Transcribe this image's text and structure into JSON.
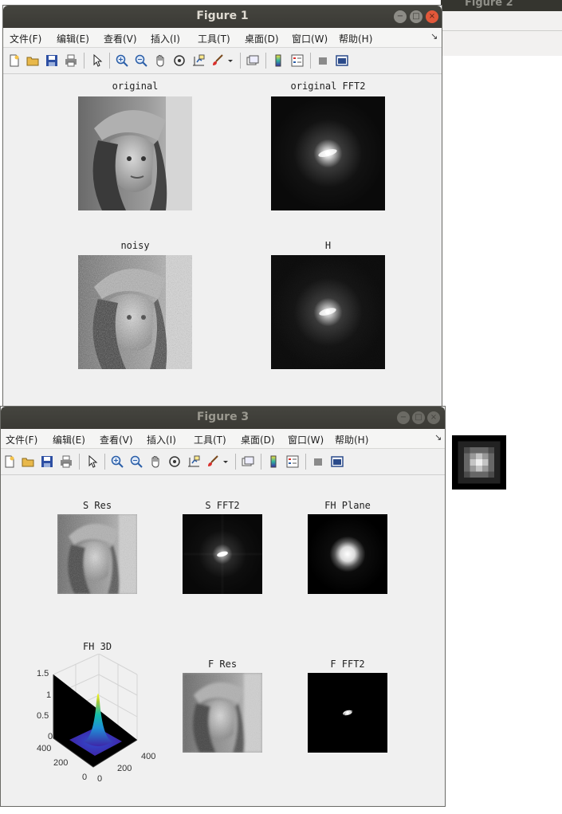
{
  "background_window": {
    "title": "Figure 2"
  },
  "figure1": {
    "title": "Figure 1",
    "menu": [
      "文件(F)",
      "编辑(E)",
      "查看(V)",
      "插入(I)",
      "工具(T)",
      "桌面(D)",
      "窗口(W)",
      "帮助(H)"
    ],
    "menu_more": "↘",
    "axes": [
      {
        "title": "original"
      },
      {
        "title": "original FFT2"
      },
      {
        "title": "noisy"
      },
      {
        "title": "H"
      }
    ]
  },
  "figure3": {
    "title": "Figure 3",
    "menu": [
      "文件(F)",
      "编辑(E)",
      "查看(V)",
      "插入(I)",
      "工具(T)",
      "桌面(D)",
      "窗口(W)",
      "帮助(H)"
    ],
    "menu_more": "↘",
    "axes": [
      {
        "title": "S Res"
      },
      {
        "title": "S FFT2"
      },
      {
        "title": "FH Plane"
      },
      {
        "title": "FH 3D"
      },
      {
        "title": "F Res"
      },
      {
        "title": "F FFT2"
      }
    ],
    "surf_ticks": {
      "z": [
        "1.5",
        "1",
        "0.5",
        "0"
      ],
      "left": [
        "400",
        "200",
        "0"
      ],
      "right": [
        "0",
        "200",
        "400"
      ]
    }
  },
  "window_controls": {
    "minimize": "−",
    "maximize": "□",
    "close": "×"
  },
  "colors": {
    "titlebar": "#3b3a35",
    "close": "#e2583a",
    "figure_bg": "#f0f0f0"
  }
}
